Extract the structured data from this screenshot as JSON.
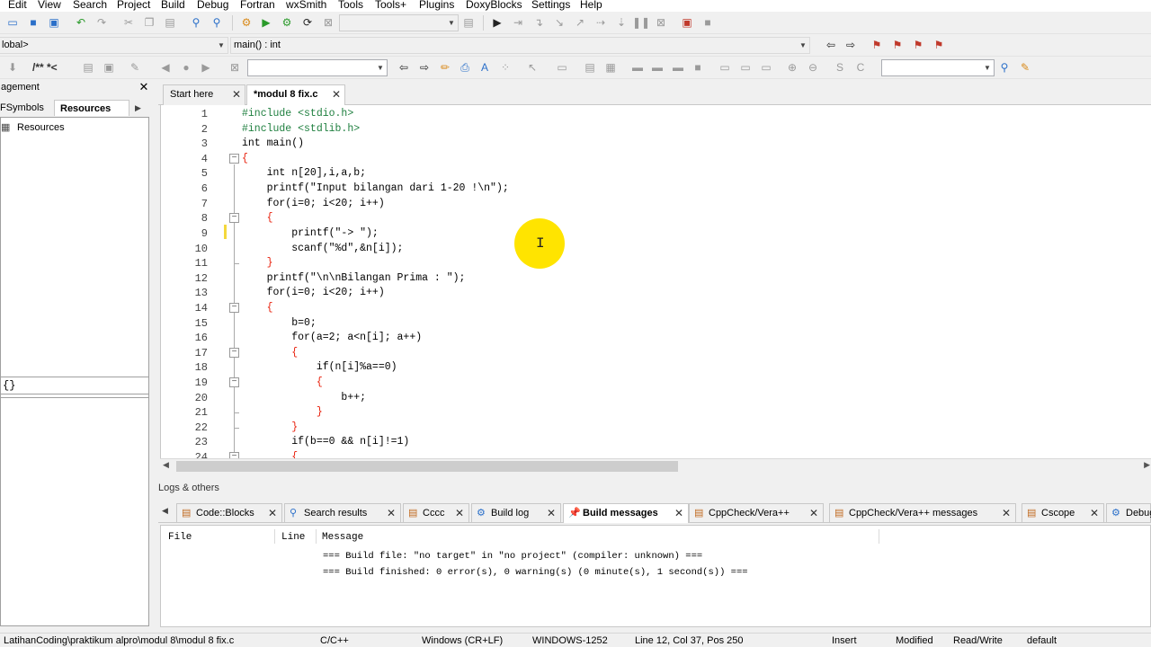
{
  "menu": [
    "Edit",
    "View",
    "Search",
    "Project",
    "Build",
    "Debug",
    "Fortran",
    "wxSmith",
    "Tools",
    "Tools+",
    "Plugins",
    "DoxyBlocks",
    "Settings",
    "Help"
  ],
  "toolbar2": {
    "scope_combo": "lobal>",
    "function_combo": "main() : int"
  },
  "toolbar3": {
    "comment_buttons": "/** *<",
    "build_target_combo": "",
    "search_combo": ""
  },
  "left_panel": {
    "title": "agement",
    "tabs": [
      "FSymbols",
      "Resources"
    ],
    "active_tab": "Resources",
    "tree_root": "Resources",
    "symbol_box": "{}"
  },
  "editor_tabs": [
    {
      "label": "Start here",
      "active": false
    },
    {
      "label": "*modul 8 fix.c",
      "active": true
    }
  ],
  "editor": {
    "line_numbers": [
      "1",
      "2",
      "3",
      "4",
      "5",
      "6",
      "7",
      "8",
      "9",
      "10",
      "11",
      "12",
      "13",
      "14",
      "15",
      "16",
      "17",
      "18",
      "19",
      "20",
      "21",
      "22",
      "23",
      "24"
    ],
    "code": [
      "#include <stdio.h>",
      "#include <stdlib.h>",
      "int main()",
      "{",
      "    int n[20],i,a,b;",
      "    printf(\"Input bilangan dari 1-20 !\\n\");",
      "    for(i=0; i<20; i++)",
      "    {",
      "        printf(\"-> \");",
      "        scanf(\"%d\",&n[i]);",
      "    }",
      "    printf(\"\\n\\nBilangan Prima : \");",
      "    for(i=0; i<20; i++)",
      "    {",
      "        b=0;",
      "        for(a=2; a<n[i]; a++)",
      "        {",
      "            if(n[i]%a==0)",
      "            {",
      "                b++;",
      "            }",
      "        }",
      "        if(b==0 && n[i]!=1)",
      "        {"
    ]
  },
  "logs": {
    "title": "Logs & others",
    "tabs": [
      "Code::Blocks",
      "Search results",
      "Cccc",
      "Build log",
      "Build messages",
      "CppCheck/Vera++",
      "CppCheck/Vera++ messages",
      "Cscope",
      "Debug"
    ],
    "active_tab": "Build messages",
    "columns": [
      "File",
      "Line",
      "Message"
    ],
    "messages": [
      "=== Build file: \"no target\" in \"no project\" (compiler: unknown) ===",
      "=== Build finished: 0 error(s), 0 warning(s) (0 minute(s), 1 second(s)) ==="
    ]
  },
  "status": {
    "path": "LatihanCoding\\praktikum alpro\\modul 8\\modul 8 fix.c",
    "language": "C/C++",
    "line_endings": "Windows (CR+LF)",
    "encoding": "WINDOWS-1252",
    "position": "Line 12, Col 37, Pos 250",
    "mode": "Insert",
    "modified": "Modified",
    "access": "Read/Write",
    "profile": "default"
  },
  "colors": {
    "preprocessor": "#208040",
    "keyword": "#00008b",
    "number": "#e0509a",
    "string": "#0000c8",
    "operator": "#e8200c",
    "cursor_highlight": "#ffe400"
  }
}
